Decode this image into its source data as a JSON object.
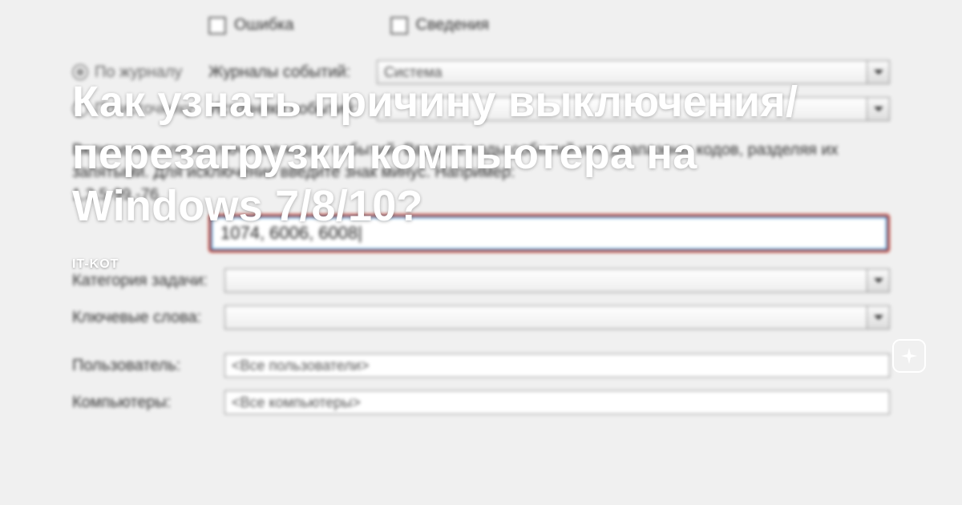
{
  "overlay": {
    "title": "Как узнать причину выключения/перезагрузки компьютера на Windows 7/8/10?",
    "brand": "IT-KOT"
  },
  "checks": {
    "error": "Ошибка",
    "info": "Сведения"
  },
  "radios": {
    "byLog": "По журналу",
    "bySource": "По источнику"
  },
  "labels": {
    "eventLogs": "Журналы событий:",
    "eventSources": "Источники событий:",
    "taskCategory": "Категория задачи:",
    "keywords": "Ключевые слова:",
    "user": "Пользователь:",
    "computers": "Компьютеры:"
  },
  "values": {
    "eventLogs": "Система",
    "eventSources": "",
    "codes": "1074, 6006, 6008",
    "taskCategory": "",
    "keywords": "",
    "user": "<Все пользователи>",
    "computers": "<Все компьютеры>"
  },
  "help": {
    "line1": "Включение или исключение кодов событий. Введите коды событий или диапазоны кодов, разделяя их запятыми. Для исключения введите знак минус. Например:",
    "line2": "1,3,5-99,-76"
  }
}
